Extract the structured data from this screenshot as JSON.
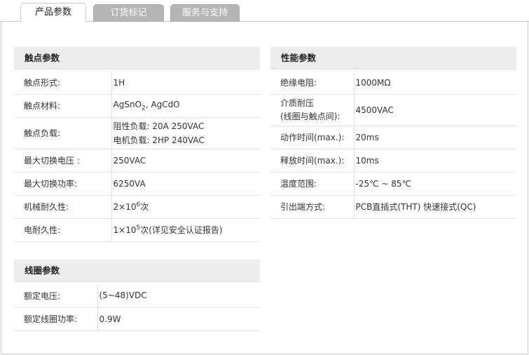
{
  "tabs": [
    {
      "label": "产品参数"
    },
    {
      "label": "订货标记"
    },
    {
      "label": "服务与支持"
    }
  ],
  "contact": {
    "title": "触点参数",
    "rows": [
      {
        "key": "触点形式:",
        "value": "1H"
      },
      {
        "key": "触点材料:",
        "value_parts": [
          "AgSnO",
          "2",
          ", AgCdO"
        ]
      },
      {
        "key": "触点负载:",
        "lines": [
          "阻性负载: 20A 250VAC",
          "电机负载: 2HP 240VAC"
        ]
      },
      {
        "key": "最大切换电压 :",
        "value": "250VAC"
      },
      {
        "key": "最大切换功率:",
        "value": "6250VA"
      },
      {
        "key": "机械耐久性:",
        "value_parts": [
          "2×10",
          "6",
          "次"
        ]
      },
      {
        "key": "电耐久性:",
        "value_parts": [
          "1×10",
          "5",
          "次(详见安全认证报告)"
        ]
      }
    ]
  },
  "coil": {
    "title": "线圈参数",
    "rows": [
      {
        "key": "额定电压:",
        "value": "(5~48)VDC"
      },
      {
        "key": "额定线圈功率:",
        "value": "0.9W"
      }
    ]
  },
  "performance": {
    "title": "性能参数",
    "rows": [
      {
        "key": "绝缘电阻:",
        "value": "1000MΩ"
      },
      {
        "key_lines": [
          "介质耐压",
          "(线圈与触点间):"
        ],
        "value": "4500VAC"
      },
      {
        "key": "动作时间(max.):",
        "value": "20ms"
      },
      {
        "key": "释放时间(max.):",
        "value": "10ms"
      },
      {
        "key": "温度范围:",
        "value": "-25℃ ~ 85℃"
      },
      {
        "key": "引出端方式:",
        "value": "PCB直插式(THT) 快速接式(QC)"
      }
    ]
  }
}
